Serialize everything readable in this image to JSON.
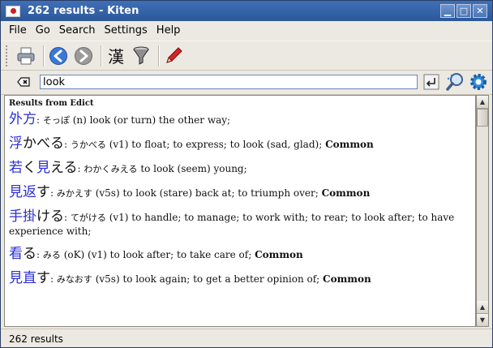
{
  "window": {
    "title": "262 results - Kiten"
  },
  "menu": [
    "File",
    "Go",
    "Search",
    "Settings",
    "Help"
  ],
  "search": {
    "value": "look"
  },
  "results": {
    "header": "Results from Edict",
    "entries": [
      {
        "kanji": "外方",
        "kana": "",
        "reading": "そっぽ",
        "definition": "(n) look (or turn) the other way;",
        "common": ""
      },
      {
        "kanji": "浮",
        "kana": "かべる",
        "reading": "うかべる",
        "definition": "(v1) to float; to express; to look (sad, glad);",
        "common": "Common"
      },
      {
        "kanji": "若",
        "kana": "く",
        "kanji2": "見",
        "kana2": "える",
        "reading": "わかくみえる",
        "definition": "to look (seem) young;",
        "common": ""
      },
      {
        "kanji": "見返",
        "kana": "す",
        "reading": "みかえす",
        "definition": "(v5s) to look (stare) back at; to triumph over;",
        "common": "Common"
      },
      {
        "kanji": "手掛",
        "kana": "ける",
        "reading": "てがける",
        "definition": "(v1) to handle; to manage; to work with; to rear; to look after; to have experience with;",
        "common": ""
      },
      {
        "kanji": "看",
        "kana": "る",
        "reading": "みる",
        "definition": "(oK) (v1) to look after; to take care of;",
        "common": "Common"
      },
      {
        "kanji": "見直",
        "kana": "す",
        "reading": "みなおす",
        "definition": "(v5s) to look again; to get a better opinion of;",
        "common": "Common"
      }
    ]
  },
  "status": {
    "text": "262 results"
  }
}
